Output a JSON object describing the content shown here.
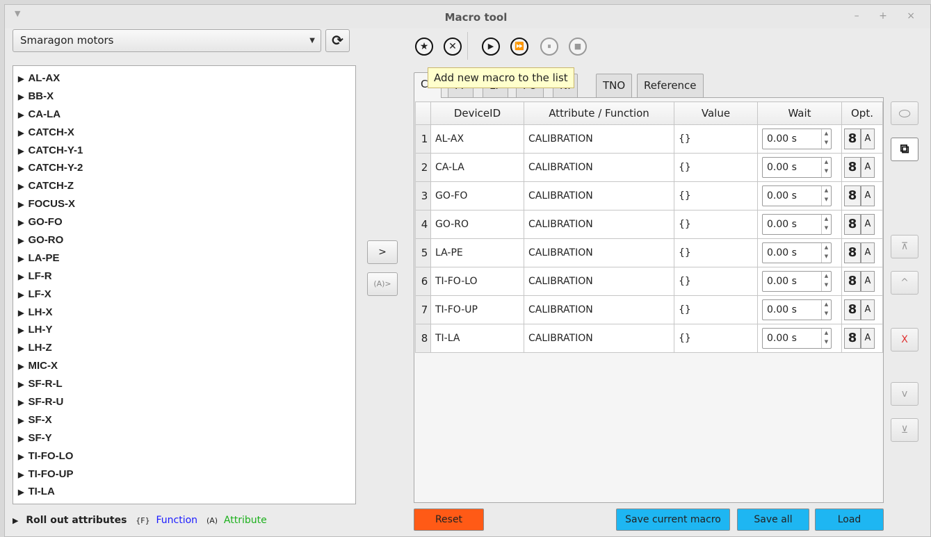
{
  "window": {
    "title": "Macro tool",
    "menu_glyph": "▼",
    "controls": "– + ×"
  },
  "left": {
    "combo_value": "Smaragon motors",
    "combo_arrow": "▼",
    "refresh_glyph": "⟳",
    "devices": [
      "AL-AX",
      "BB-X",
      "CA-LA",
      "CATCH-X",
      "CATCH-Y-1",
      "CATCH-Y-2",
      "CATCH-Z",
      "FOCUS-X",
      "GO-FO",
      "GO-RO",
      "LA-PE",
      "LF-R",
      "LF-X",
      "LH-X",
      "LH-Y",
      "LH-Z",
      "MIC-X",
      "SF-R-L",
      "SF-R-U",
      "SF-X",
      "SF-Y",
      "TI-FO-LO",
      "TI-FO-UP",
      "TI-LA"
    ],
    "legend": {
      "label": "Roll out attributes",
      "fn_tag": "{F}",
      "fn_label": "Function",
      "attr_tag": "(A)",
      "attr_label": "Attribute"
    }
  },
  "middle": {
    "add_label": ">",
    "add_attr_label": "(A)>"
  },
  "toolbar": {
    "new_glyph": "★",
    "delete_glyph": "✕",
    "play_glyph": "▶",
    "fast_glyph": "⏩",
    "pause_glyph": "⏸",
    "stop_glyph": "■",
    "tooltip": "Add new macro to the list"
  },
  "tabs": [
    "Ca",
    "FF",
    "LF",
    "FO",
    "NI",
    "TNO",
    "Reference"
  ],
  "table": {
    "headers": [
      "DeviceID",
      "Attribute / Function",
      "Value",
      "Wait",
      "Opt."
    ],
    "rows": [
      {
        "n": "1",
        "device": "AL-AX",
        "attr": "CALIBRATION",
        "value": "{}",
        "wait": "0.00 s"
      },
      {
        "n": "2",
        "device": "CA-LA",
        "attr": "CALIBRATION",
        "value": "{}",
        "wait": "0.00 s"
      },
      {
        "n": "3",
        "device": "GO-FO",
        "attr": "CALIBRATION",
        "value": "{}",
        "wait": "0.00 s"
      },
      {
        "n": "4",
        "device": "GO-RO",
        "attr": "CALIBRATION",
        "value": "{}",
        "wait": "0.00 s"
      },
      {
        "n": "5",
        "device": "LA-PE",
        "attr": "CALIBRATION",
        "value": "{}",
        "wait": "0.00 s"
      },
      {
        "n": "6",
        "device": "TI-FO-LO",
        "attr": "CALIBRATION",
        "value": "{}",
        "wait": "0.00 s"
      },
      {
        "n": "7",
        "device": "TI-FO-UP",
        "attr": "CALIBRATION",
        "value": "{}",
        "wait": "0.00 s"
      },
      {
        "n": "8",
        "device": "TI-LA",
        "attr": "CALIBRATION",
        "value": "{}",
        "wait": "0.00 s"
      }
    ],
    "link_glyph": "8",
    "a_label": "A"
  },
  "side": {
    "copy_glyph": "⧉",
    "top_glyph": "⊼",
    "up_glyph": "^",
    "remove_glyph": "X",
    "down_glyph": "v",
    "bottom_glyph": "⊻"
  },
  "bottom": {
    "reset": "Reset",
    "save_current": "Save current macro",
    "save_all": "Save all",
    "load": "Load"
  }
}
